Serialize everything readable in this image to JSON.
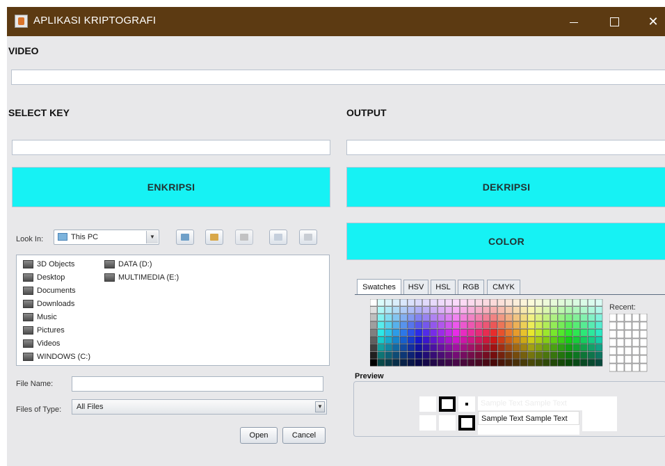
{
  "window": {
    "title": "APLIKASI KRIPTOGRAFI"
  },
  "labels": {
    "video": "VIDEO",
    "select_key": "SELECT KEY",
    "output": "OUTPUT"
  },
  "fields": {
    "video_path": "",
    "key": "",
    "output": ""
  },
  "buttons": {
    "encrypt": "ENKRIPSI",
    "decrypt": "DEKRIPSI",
    "color": "COLOR"
  },
  "file_chooser": {
    "look_in_label": "Look In:",
    "look_in_value": "This PC",
    "items": [
      "3D Objects",
      "Desktop",
      "Documents",
      "Downloads",
      "Music",
      "Pictures",
      "Videos",
      "WINDOWS (C:)",
      "DATA (D:)",
      "MULTIMEDIA (E:)"
    ],
    "file_name_label": "File Name:",
    "file_name_value": "",
    "files_of_type_label": "Files of Type:",
    "files_of_type_value": "All Files",
    "open_label": "Open",
    "cancel_label": "Cancel"
  },
  "color_chooser": {
    "tabs": [
      "Swatches",
      "HSV",
      "HSL",
      "RGB",
      "CMYK"
    ],
    "selected_tab": "Swatches",
    "recent_label": "Recent:",
    "preview_label": "Preview",
    "sample_text": "Sample Text"
  },
  "colors": {
    "titlebar": "#5c3a12",
    "button": "#16f2f4",
    "window_bg": "#e8e8ea"
  }
}
